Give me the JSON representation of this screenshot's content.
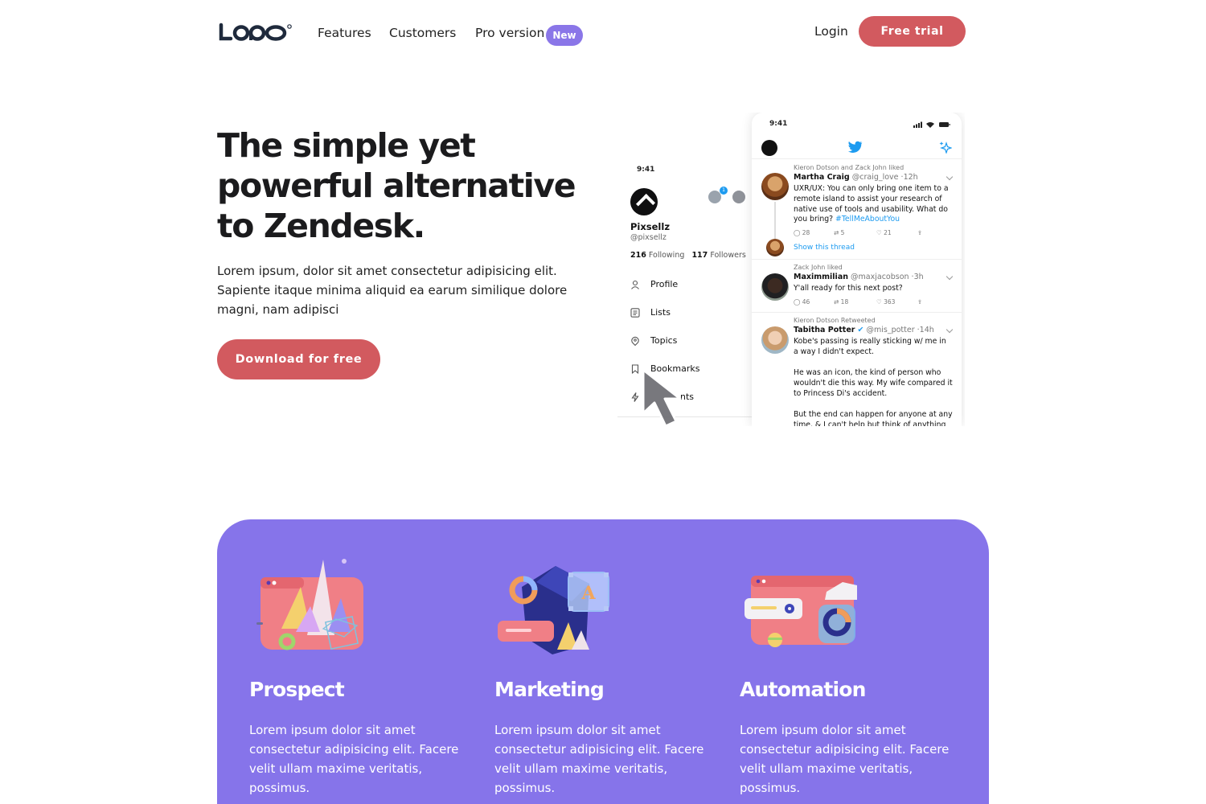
{
  "nav": {
    "logo_text": "LOGO",
    "links": [
      "Features",
      "Customers",
      "Pro version"
    ],
    "badge": "New",
    "login": "Login",
    "cta": "Free trial"
  },
  "hero": {
    "title": "The simple yet powerful alternative to Zendesk.",
    "description": "Lorem ipsum, dolor sit amet consectetur adipisicing elit. Sapiente itaque minima aliquid ea earum similique dolore magni, nam adipisci",
    "cta": "Download for free"
  },
  "mockup": {
    "profile": {
      "time": "9:41",
      "name": "Pixsellz",
      "handle": "@pixsellz",
      "following_count": "216",
      "following_label": "Following",
      "followers_count": "117",
      "followers_label": "Followers",
      "notification_count": "1",
      "menu": [
        "Profile",
        "Lists",
        "Topics",
        "Bookmarks",
        "nts"
      ]
    },
    "feed": {
      "time": "9:41",
      "tweets": [
        {
          "context": "Kieron Dotson and Zack John liked",
          "name": "Martha Craig",
          "meta": "@craig_love ·12h",
          "text": "UXR/UX: You can only bring one item to a remote island to assist your research of native use of tools and usability. What do you bring?",
          "hashtag": "#TellMeAboutYou",
          "replies": "28",
          "retweets": "5",
          "likes": "21",
          "show_thread": "Show this thread"
        },
        {
          "context": "Zack John liked",
          "name": "Maximmilian",
          "meta": "@maxjacobson ·3h",
          "text": "Y'all ready for this next post?",
          "replies": "46",
          "retweets": "18",
          "likes": "363"
        },
        {
          "context": "Kieron Dotson Retweeted",
          "name": "Tabitha Potter",
          "meta": "@mis_potter ·14h",
          "text": "Kobe's passing is really sticking w/ me in a way I didn't expect.",
          "text2": "He was an icon, the kind of person who wouldn't die this way. My wife compared it to Princess Di's accident.",
          "text3": "But the end can happen for anyone at any time, & I can't help but think of anything"
        }
      ]
    }
  },
  "features": [
    {
      "title": "Prospect",
      "description": "Lorem ipsum dolor sit amet consectetur adipisicing elit. Facere velit ullam maxime veritatis, possimus."
    },
    {
      "title": "Marketing",
      "description": "Lorem ipsum dolor sit amet consectetur adipisicing elit. Facere velit ullam maxime veritatis, possimus."
    },
    {
      "title": "Automation",
      "description": "Lorem ipsum dolor sit amet consectetur adipisicing elit. Facere velit ullam maxime veritatis, possimus."
    }
  ],
  "colors": {
    "accent_red": "#d25a5f",
    "accent_purple": "#8674ea",
    "badge_purple": "#8a76e8",
    "twitter_blue": "#1d9bf0"
  }
}
